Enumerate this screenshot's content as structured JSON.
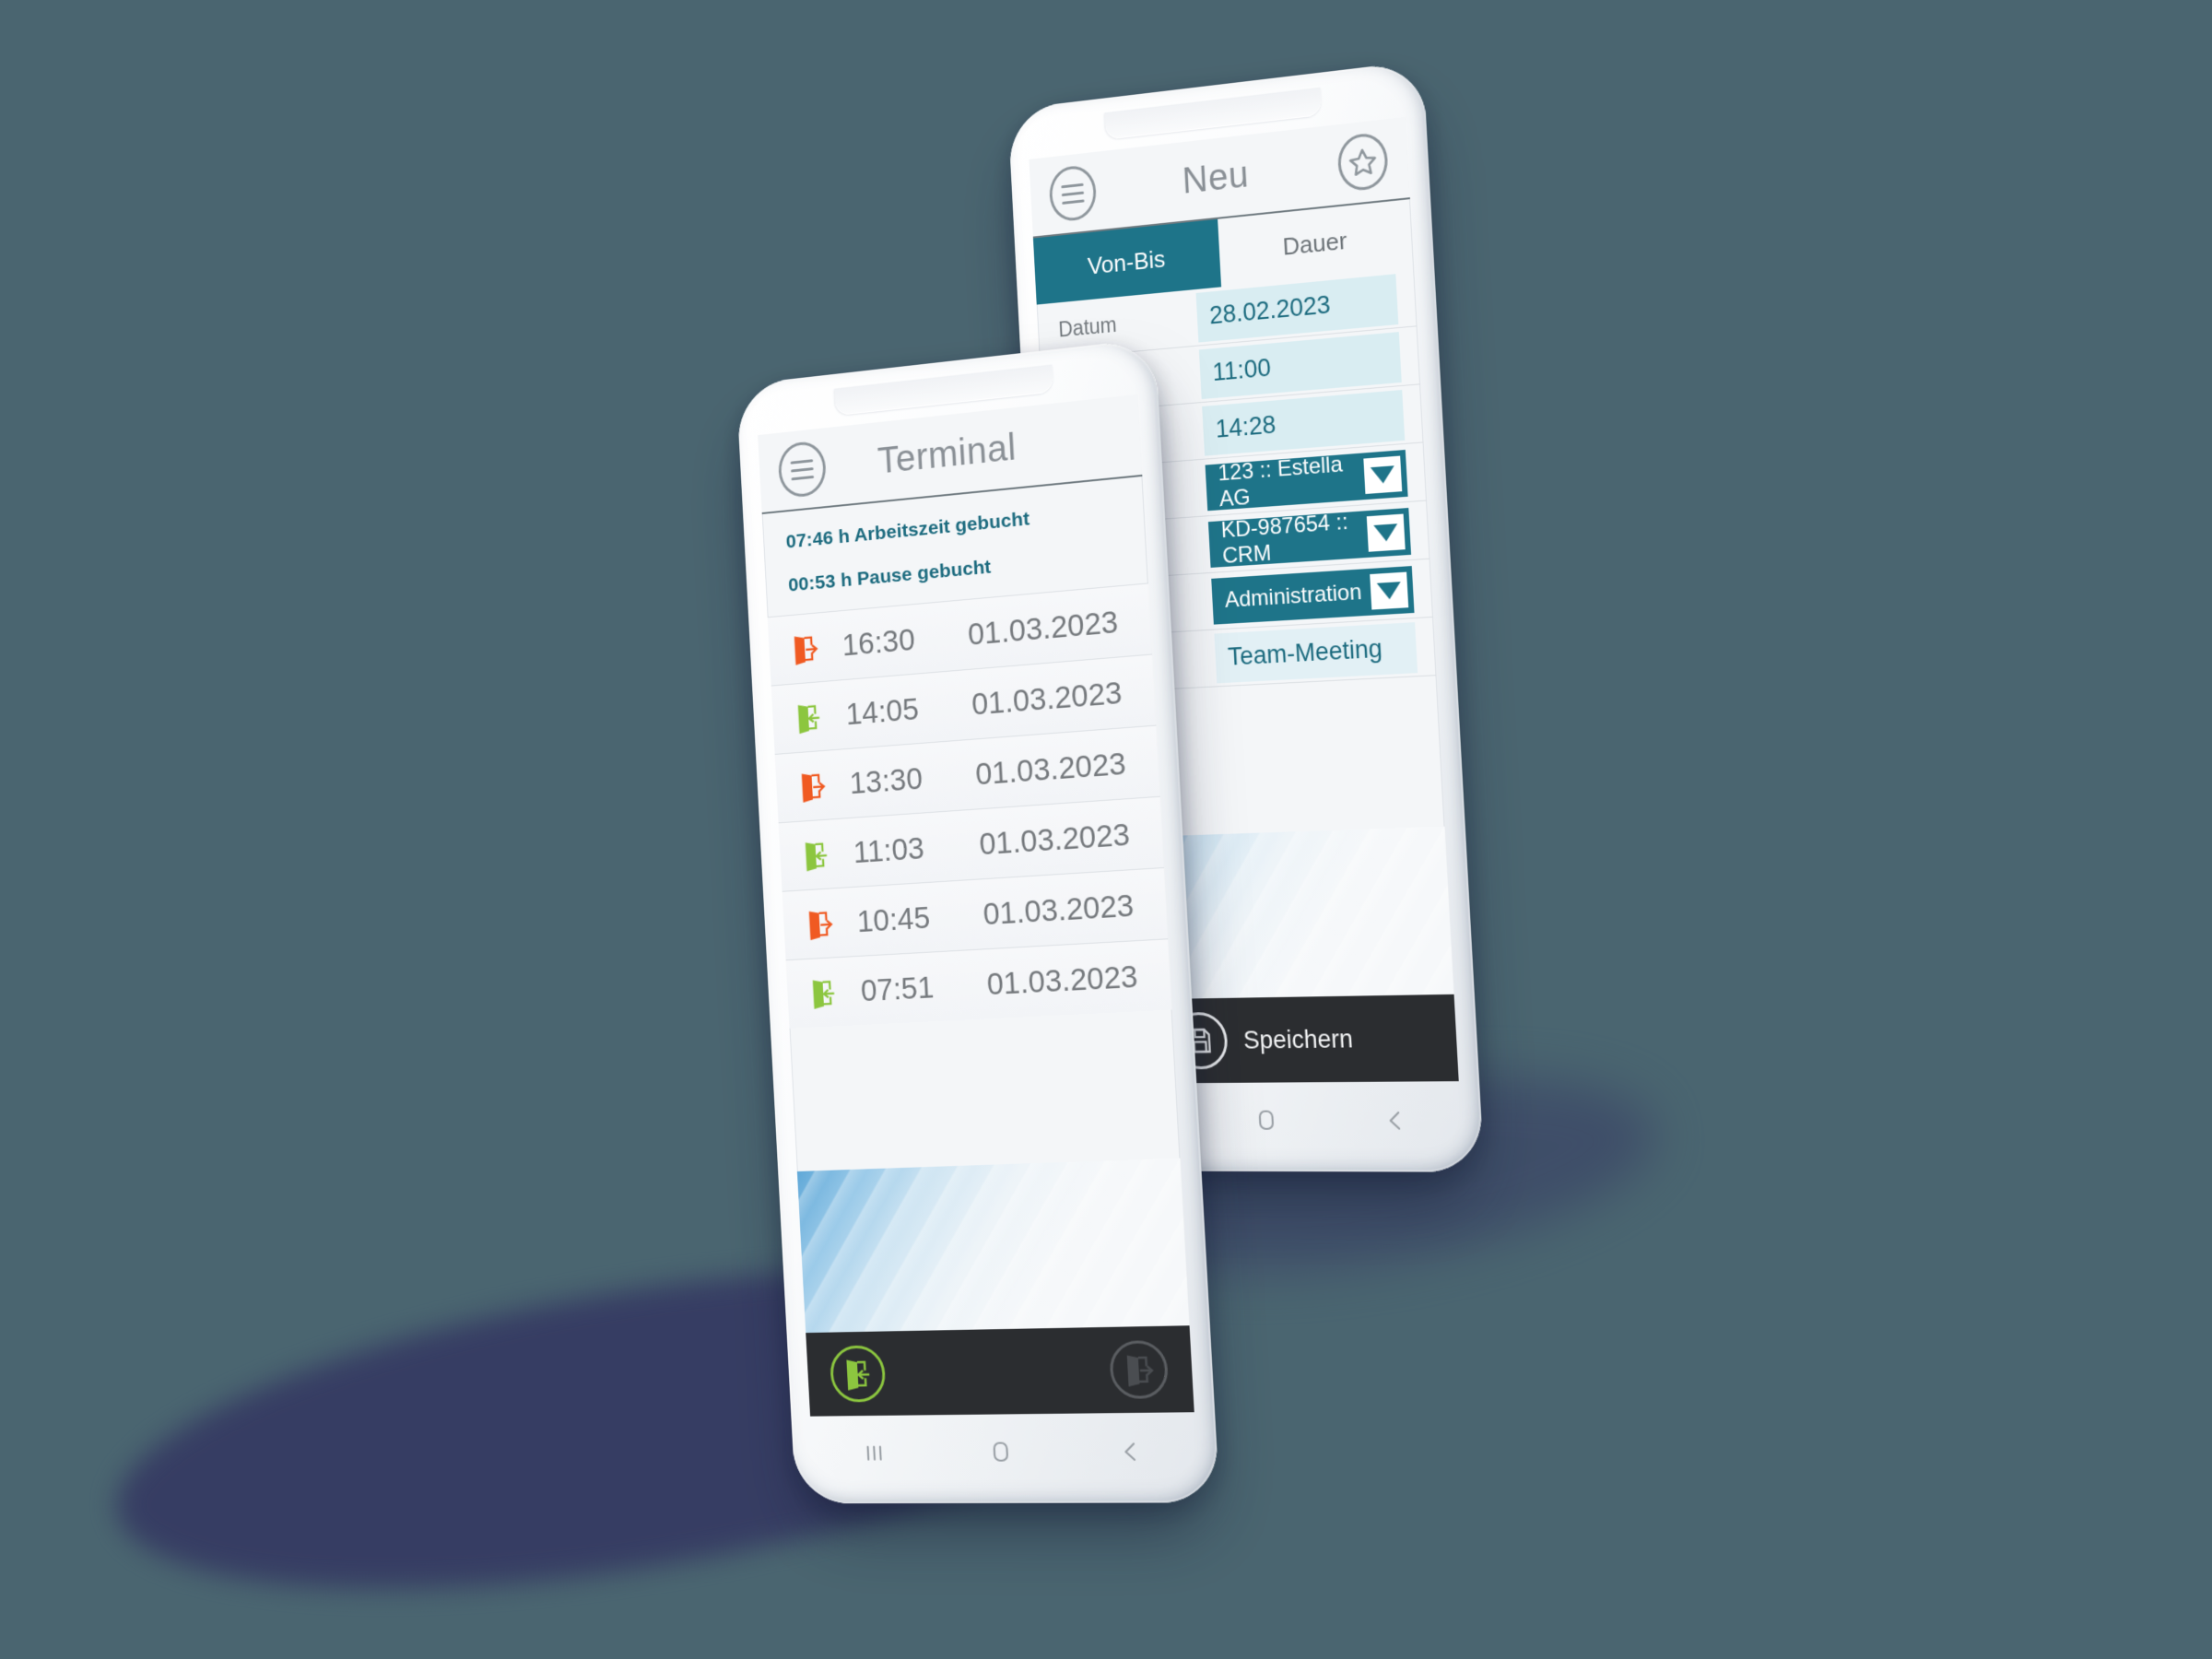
{
  "theme": {
    "background": "#4a6570",
    "shadow": "#363c63",
    "accent_teal": "#1e7489",
    "accent_teal_text": "#1b6a7e",
    "field_bg": "#d9edf2",
    "action_bar": "#2b2d30",
    "green": "#8cc63f",
    "orange": "#f05a22",
    "muted_text": "#75797d"
  },
  "front_phone": {
    "header": {
      "menu_icon": "hamburger-menu-icon",
      "title": "Terminal"
    },
    "status_lines": [
      "07:46 h Arbeitszeit gebucht",
      "00:53 h Pause gebucht"
    ],
    "entries": [
      {
        "direction": "out",
        "icon": "door-exit-icon",
        "time": "16:30",
        "date": "01.03.2023"
      },
      {
        "direction": "in",
        "icon": "door-enter-icon",
        "time": "14:05",
        "date": "01.03.2023"
      },
      {
        "direction": "out",
        "icon": "door-exit-icon",
        "time": "13:30",
        "date": "01.03.2023"
      },
      {
        "direction": "in",
        "icon": "door-enter-icon",
        "time": "11:03",
        "date": "01.03.2023"
      },
      {
        "direction": "out",
        "icon": "door-exit-icon",
        "time": "10:45",
        "date": "01.03.2023"
      },
      {
        "direction": "in",
        "icon": "door-enter-icon",
        "time": "07:51",
        "date": "01.03.2023"
      }
    ],
    "action_bar": {
      "check_in_icon": "door-enter-icon",
      "check_out_icon": "door-exit-icon"
    },
    "nav_bar": {
      "recents_icon": "recents-icon",
      "home_icon": "home-icon",
      "back_icon": "back-icon"
    }
  },
  "back_phone": {
    "header": {
      "menu_icon": "hamburger-menu-icon",
      "title": "Neu",
      "favorite_icon": "star-icon"
    },
    "tabs": [
      {
        "label": "Von-Bis",
        "active": true
      },
      {
        "label": "Dauer",
        "active": false
      }
    ],
    "form": {
      "date_label": "Datum",
      "date_value": "28.02.2023",
      "time_from": "11:00",
      "time_to": "14:28",
      "customer": "123 :: Estella AG",
      "project": "KD-987654 :: CRM",
      "activity": "Administration",
      "note": "Team-Meeting"
    },
    "save": {
      "icon": "save-floppy-icon",
      "label": "Speichern"
    },
    "nav_bar": {
      "home_icon": "home-icon",
      "back_icon": "back-icon"
    }
  }
}
